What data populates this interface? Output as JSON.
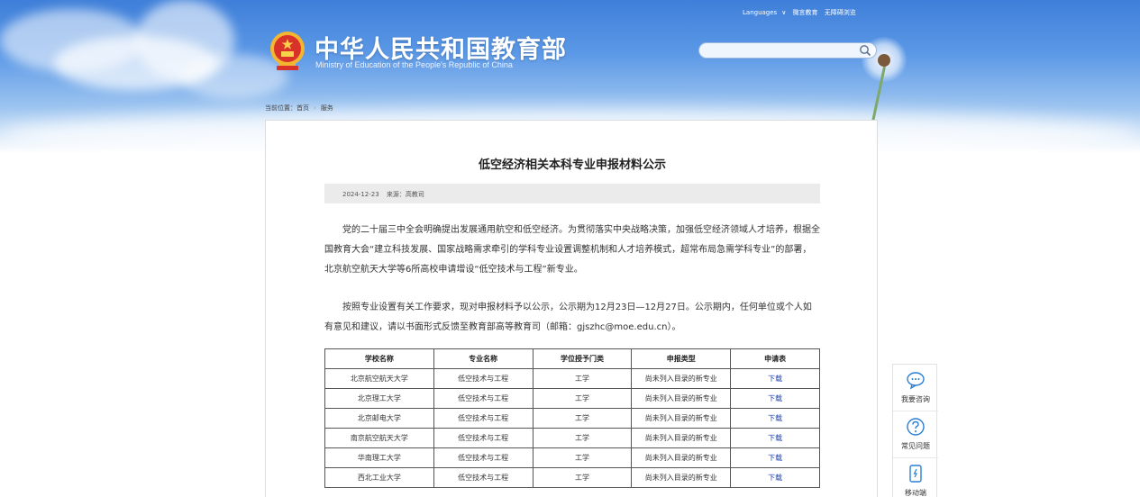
{
  "header": {
    "title": "中华人民共和国教育部",
    "subtitle": "Ministry of Education of the People's Republic of China",
    "top_links": [
      "Languages",
      "微言教育",
      "无障碍浏览"
    ],
    "search": {
      "placeholder": ""
    }
  },
  "breadcrumb": {
    "prefix": "当前位置：",
    "items": [
      "首页",
      "服务"
    ]
  },
  "article": {
    "title": "低空经济相关本科专业申报材料公示",
    "date": "2024-12-23",
    "source": "来源：高教司",
    "paragraphs": [
      "党的二十届三中全会明确提出发展通用航空和低空经济。为贯彻落实中央战略决策，加强低空经济领域人才培养，根据全国教育大会“建立科技发展、国家战略需求牵引的学科专业设置调整机制和人才培养模式，超常布局急需学科专业”的部署，北京航空航天大学等6所高校申请增设“低空技术与工程”新专业。",
      "按照专业设置有关工作要求，现对申报材料予以公示，公示期为12月23日—12月27日。公示期内，任何单位或个人如有意见和建议，请以书面形式反馈至教育部高等教育司（邮箱：gjszhc@moe.edu.cn）。"
    ],
    "table": {
      "headers": [
        "学校名称",
        "专业名称",
        "学位授予门类",
        "申报类型",
        "申请表"
      ],
      "rows": [
        [
          "北京航空航天大学",
          "低空技术与工程",
          "工学",
          "尚未列入目录的新专业",
          "下载"
        ],
        [
          "北京理工大学",
          "低空技术与工程",
          "工学",
          "尚未列入目录的新专业",
          "下载"
        ],
        [
          "北京邮电大学",
          "低空技术与工程",
          "工学",
          "尚未列入目录的新专业",
          "下载"
        ],
        [
          "南京航空航天大学",
          "低空技术与工程",
          "工学",
          "尚未列入目录的新专业",
          "下载"
        ],
        [
          "华南理工大学",
          "低空技术与工程",
          "工学",
          "尚未列入目录的新专业",
          "下载"
        ],
        [
          "西北工业大学",
          "低空技术与工程",
          "工学",
          "尚未列入目录的新专业",
          "下载"
        ]
      ]
    }
  },
  "side_tools": [
    {
      "label": "我要咨询",
      "icon": "chat-icon"
    },
    {
      "label": "常见问题",
      "icon": "question-icon"
    },
    {
      "label": "移动端",
      "icon": "mobile-icon"
    }
  ],
  "colors": {
    "sky": "#3f7fd9",
    "link": "#1a3fb5",
    "accent": "#d9322a",
    "gold": "#f2b630"
  }
}
